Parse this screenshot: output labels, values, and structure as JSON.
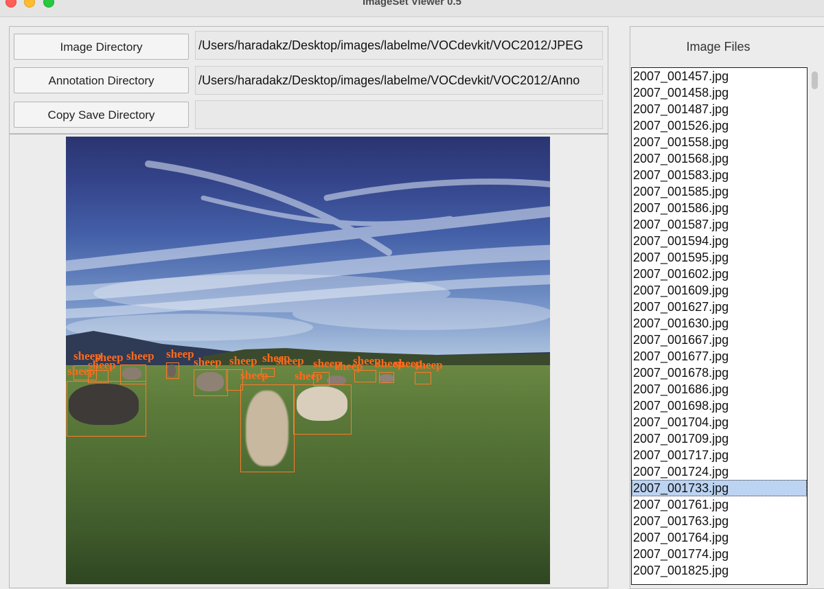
{
  "window": {
    "title": "ImageSet Viewer 0.5"
  },
  "controls": {
    "image_dir_button": "Image Directory",
    "image_dir_value": "/Users/haradakz/Desktop/images/labelme/VOCdevkit/VOC2012/JPEG",
    "annotation_dir_button": "Annotation Directory",
    "annotation_dir_value": "/Users/haradakz/Desktop/images/labelme/VOCdevkit/VOC2012/Anno",
    "copy_save_dir_button": "Copy Save Directory",
    "copy_save_dir_value": ""
  },
  "viewer": {
    "annotation_label": "sheep",
    "annotation_color": "#ff7a2a"
  },
  "file_list": {
    "title": "Image Files",
    "selected": "2007_001733.jpg",
    "items": [
      "2007_001457.jpg",
      "2007_001458.jpg",
      "2007_001487.jpg",
      "2007_001526.jpg",
      "2007_001558.jpg",
      "2007_001568.jpg",
      "2007_001583.jpg",
      "2007_001585.jpg",
      "2007_001586.jpg",
      "2007_001587.jpg",
      "2007_001594.jpg",
      "2007_001595.jpg",
      "2007_001602.jpg",
      "2007_001609.jpg",
      "2007_001627.jpg",
      "2007_001630.jpg",
      "2007_001667.jpg",
      "2007_001677.jpg",
      "2007_001678.jpg",
      "2007_001686.jpg",
      "2007_001698.jpg",
      "2007_001704.jpg",
      "2007_001709.jpg",
      "2007_001717.jpg",
      "2007_001724.jpg",
      "2007_001733.jpg",
      "2007_001761.jpg",
      "2007_001763.jpg",
      "2007_001764.jpg",
      "2007_001774.jpg",
      "2007_001825.jpg"
    ]
  }
}
